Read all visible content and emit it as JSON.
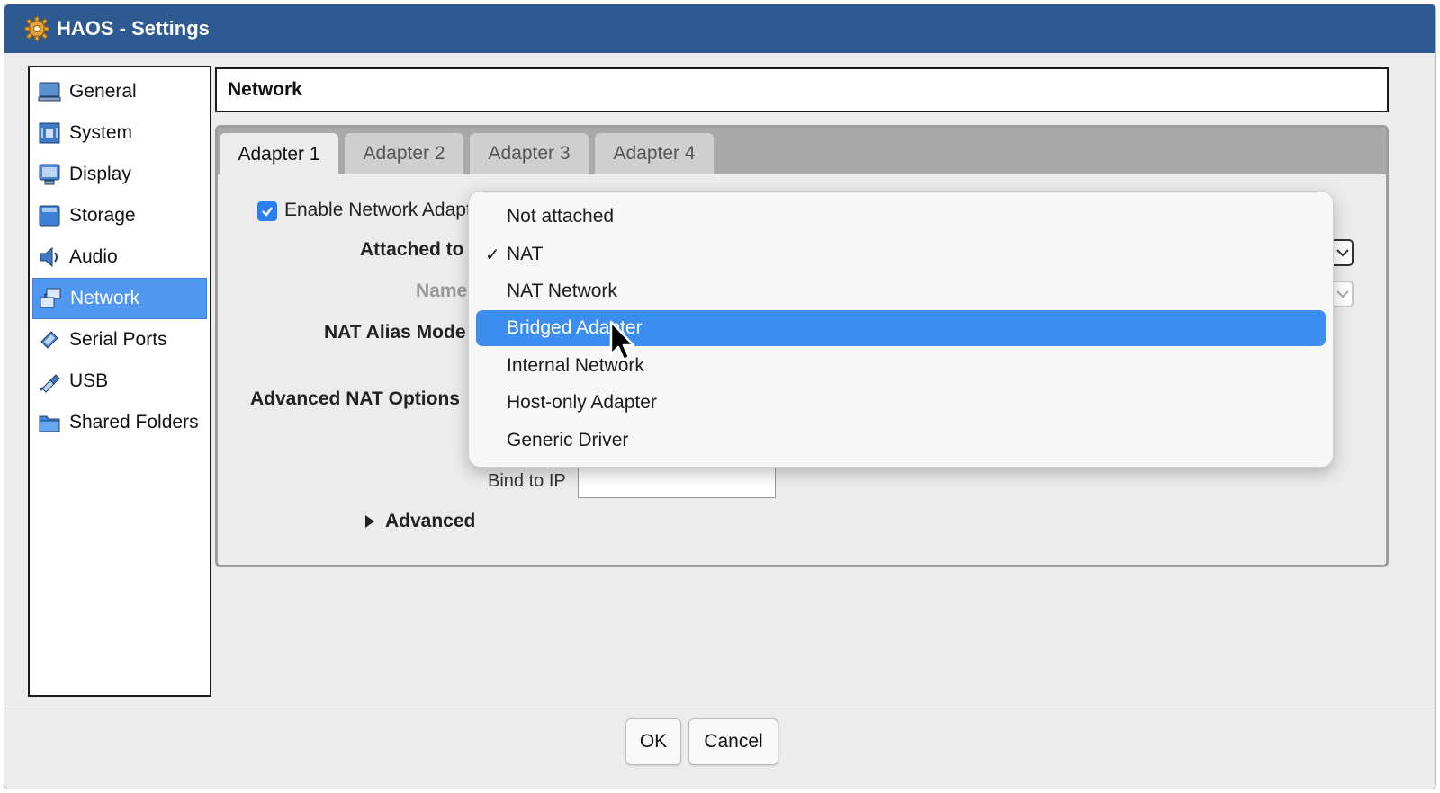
{
  "window": {
    "title": "HAOS - Settings",
    "title_icon": "gear-icon"
  },
  "sidebar": {
    "items": [
      {
        "label": "General",
        "icon": "general-icon"
      },
      {
        "label": "System",
        "icon": "system-icon"
      },
      {
        "label": "Display",
        "icon": "display-icon"
      },
      {
        "label": "Storage",
        "icon": "storage-icon"
      },
      {
        "label": "Audio",
        "icon": "audio-icon"
      },
      {
        "label": "Network",
        "icon": "network-icon",
        "selected": true
      },
      {
        "label": "Serial Ports",
        "icon": "serial-ports-icon"
      },
      {
        "label": "USB",
        "icon": "usb-icon"
      },
      {
        "label": "Shared Folders",
        "icon": "shared-folders-icon"
      }
    ]
  },
  "section": {
    "title": "Network"
  },
  "tabs": [
    {
      "label": "Adapter 1",
      "active": true
    },
    {
      "label": "Adapter 2"
    },
    {
      "label": "Adapter 3"
    },
    {
      "label": "Adapter 4"
    }
  ],
  "form": {
    "enable_label": "Enable Network Adapte",
    "enable_checked": true,
    "attached_to_label": "Attached to",
    "name_label": "Name",
    "nat_alias_label": "NAT Alias Mode",
    "advanced_nat_label": "Advanced NAT Options",
    "bind_to_ip_label": "Bind to IP",
    "bind_to_ip_value": "",
    "advanced_label": "Advanced"
  },
  "dropdown": {
    "options": [
      {
        "label": "Not attached"
      },
      {
        "label": "NAT",
        "checked": true
      },
      {
        "label": "NAT Network"
      },
      {
        "label": "Bridged Adapter",
        "highlighted": true
      },
      {
        "label": "Internal Network"
      },
      {
        "label": "Host-only Adapter"
      },
      {
        "label": "Generic Driver"
      }
    ]
  },
  "buttons": {
    "ok": "OK",
    "cancel": "Cancel"
  },
  "colors": {
    "titlebar": "#2d5b91",
    "selection": "#4f97f0",
    "highlight": "#3c8df0",
    "checkbox": "#2d7ef2"
  }
}
